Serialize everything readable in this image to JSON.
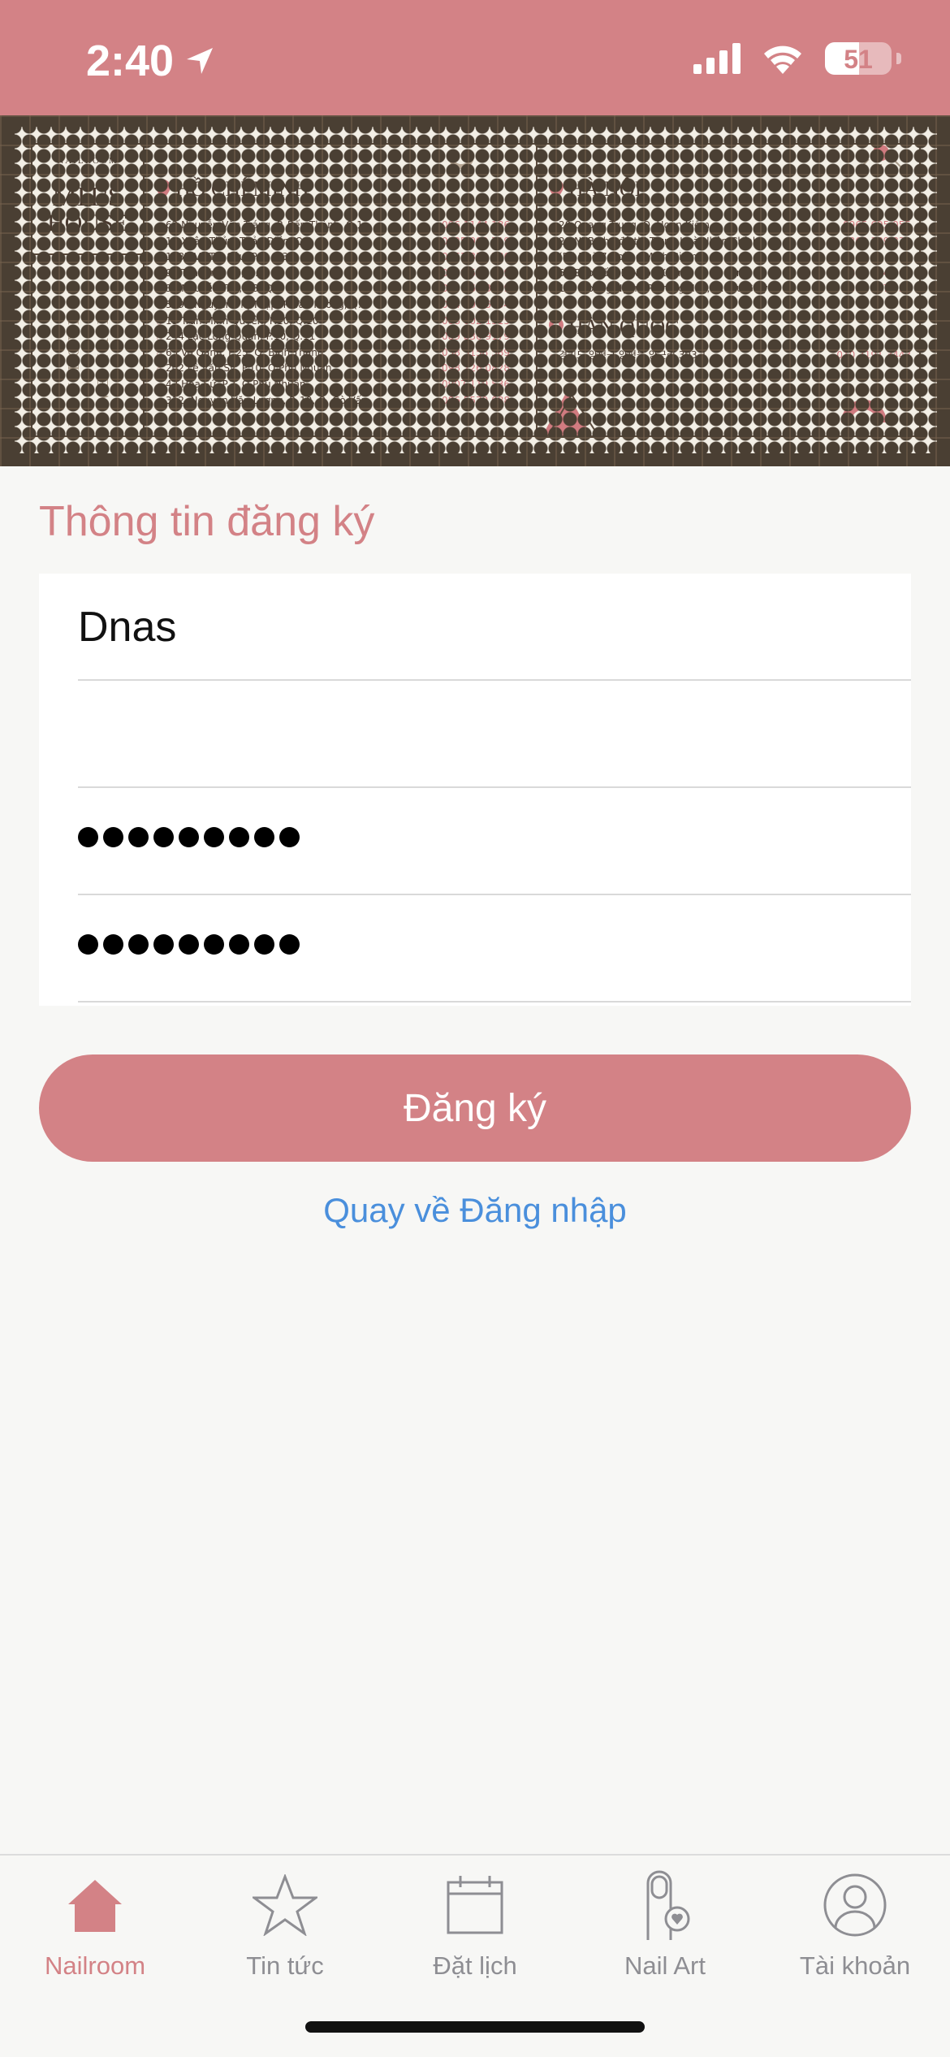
{
  "status_bar": {
    "time": "2:40",
    "battery_percent": "51",
    "battery_level": 0.51
  },
  "banner": {
    "logo_small": "NAILROOM",
    "logo_line1": "MIT'S",
    "logo_line2": "HOUSE",
    "tagline1": "YOU LOVE IT",
    "tagline2": "WE NAIL IT",
    "hcm": {
      "title": "HỒ CHÍ MINH",
      "rows": [
        {
          "address": "62 Nguyễn Văn Tráng, P. Bến Thành, Q.1",
          "phone": "096 1144 186"
        },
        {
          "address": "17 Xuân Thủy, Thảo Điền, Q.2",
          "phone": "0325 999 719"
        },
        {
          "address": "148B Võ Thị Sáu, P.8, Q.3",
          "phone": "0961 354 286"
        },
        {
          "address": "99 Tân Vĩnh, P6, Q.4",
          "phone": "0888 505 399"
        },
        {
          "address": "30 Nguyễn Trãi, P.3, Q.5",
          "phone": "034 862 3959"
        },
        {
          "address": "539B Nguyễn Thị Thập, P. Tân Phong, Q.7",
          "phone": "034 596 5834"
        },
        {
          "address": "15 Trần Minh Quyền, P.10, Q.10",
          "phone": "088 602 1515"
        },
        {
          "address": "244 Lạc Long Quân, P.10, Q.11",
          "phone": "089 830 9179"
        },
        {
          "address": "65 Võ Oanh, P.25, Q. Bình Thạnh",
          "phone": "038 5158 589"
        },
        {
          "address": "202 Lê Văn Sỹ, P.10, Q Phú Nhuận",
          "phone": "098 726 0828"
        },
        {
          "address": "42 Hoa Sứ, P.2, Q Phú Nhuận",
          "phone": "0907 119 536"
        },
        {
          "address": "312, Nguyễn Văn Lượng, P. 10, Q. Gò Vấp",
          "phone": "086 5579 088"
        }
      ]
    },
    "hn": {
      "title": "HÀ NỘI",
      "rows": [
        {
          "address": "20 Quang Trung, Q. Hoàn Kiếm",
          "phone": "0965 695 055"
        },
        {
          "address": "29 N7B khu đô thị Trung Hoà Nhân Chính",
          "phone": "0368 389 839"
        },
        {
          "address": "(Rẽ Ngõ 7 Hoàng Minh Giám)",
          "phone": ""
        },
        {
          "address": "56 Đào Tấn, P. Ngọc Khánh, Q. Ba Đình",
          "phone": "0868 864 966"
        },
        {
          "address": "149 Hoàng Ngân, P. Trung Hòa, Q.Cầu Giấy",
          "phone": "0395 937 538"
        }
      ]
    },
    "kr": {
      "title": "HÀN QUỐC",
      "rows": [
        {
          "address": "경기도 양평군 양평읍 양근리 303-1",
          "phone": "010 7191 3443"
        }
      ]
    }
  },
  "form": {
    "title": "Thông tin đăng ký",
    "name_value": "Dnas",
    "second_field_value": "",
    "password_mask": "•••••••••",
    "confirm_mask": "•••••••••",
    "register_label": "Đăng ký",
    "back_to_login": "Quay về Đăng nhập"
  },
  "tabs": [
    {
      "label": "Nailroom",
      "icon": "home-icon",
      "active": true
    },
    {
      "label": "Tin tức",
      "icon": "star-icon",
      "active": false
    },
    {
      "label": "Đặt lịch",
      "icon": "calendar-icon",
      "active": false
    },
    {
      "label": "Nail Art",
      "icon": "nail-art-icon",
      "active": false
    },
    {
      "label": "Tài khoản",
      "icon": "account-icon",
      "active": false
    }
  ],
  "colors": {
    "accent": "#d38286",
    "link": "#4a8fdc"
  }
}
